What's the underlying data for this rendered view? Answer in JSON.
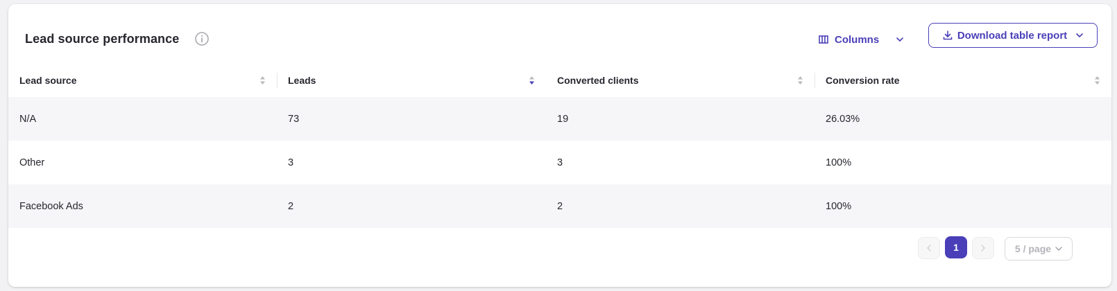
{
  "card": {
    "title": "Lead source performance"
  },
  "toolbar": {
    "columns_label": "Columns",
    "download_label": "Download table report"
  },
  "table": {
    "headers": [
      "Lead source",
      "Leads",
      "Converted clients",
      "Conversion rate"
    ],
    "rows": [
      [
        "N/A",
        "73",
        "19",
        "26.03%"
      ],
      [
        "Other",
        "3",
        "3",
        "100%"
      ],
      [
        "Facebook Ads",
        "2",
        "2",
        "100%"
      ]
    ]
  },
  "pagination": {
    "current_page": "1",
    "page_size": "5 / page"
  },
  "colors": {
    "accent": "#4a3fb8",
    "zebra_row": "#f6f6f8",
    "text": "#26262e"
  },
  "icons": [
    "info-icon",
    "columns-icon",
    "chevron-down-icon",
    "download-icon",
    "sort-icon",
    "chevron-left-icon",
    "chevron-right-icon"
  ]
}
